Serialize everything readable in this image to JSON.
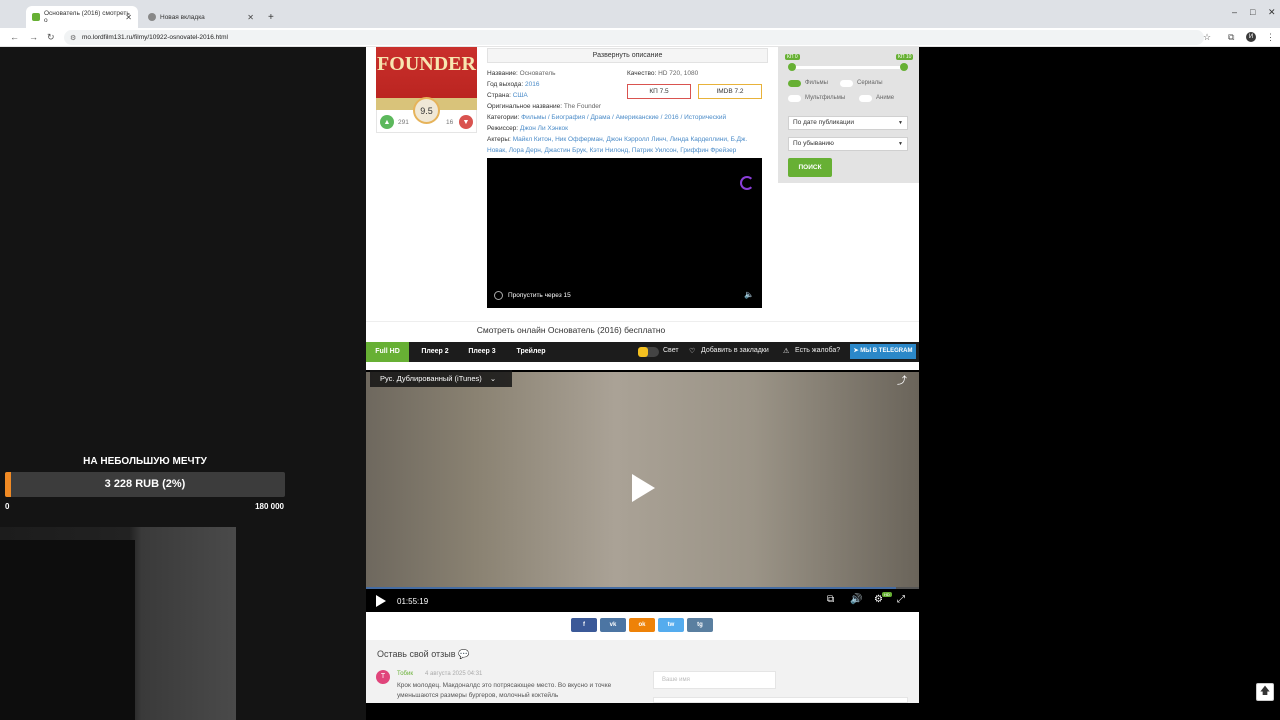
{
  "browser": {
    "tabs": [
      {
        "title": "Основатель (2016) смотреть о",
        "active": true
      },
      {
        "title": "Новая вкладка",
        "active": false
      }
    ],
    "new_tab": "+",
    "url": "mo.lordfilm131.ru/filmy/10922-osnovatel-2016.html",
    "win_controls": [
      "–",
      "□",
      "✕"
    ]
  },
  "donation": {
    "title": "НА НЕБОЛЬШУЮ МЕЧТУ",
    "amount": "3 228 RUB (2%)",
    "min": "0",
    "max": "180 000",
    "progress_fraction": 0.018
  },
  "movie": {
    "poster_title": "FOUNDER",
    "rating": "9.5",
    "likes": "291",
    "dislikes": "16",
    "expand_description": "Развернуть описание",
    "fields": {
      "name_label": "Название:",
      "name": "Основатель",
      "year_label": "Год выхода:",
      "year": "2016",
      "country_label": "Страна:",
      "country": "США",
      "orig_label": "Оригинальное название:",
      "orig": "The Founder",
      "cat_label": "Категории:",
      "categories": "Фильмы / Биография / Драма / Американские / 2016 / Исторический",
      "director_label": "Режиссер:",
      "director": "Джон Ли Хэнкок",
      "actors_label": "Актеры:",
      "actors_line1": "Майкл Китон, Ник Офферман, Джон Кэрролл Линч, Линда Карделлини, Б.Дж.",
      "actors_line2": "Новак, Лора Дерн, Джастин Брук, Кэти Нилонд, Патрик Уилсон, Гриффин Фрейзер",
      "quality_label": "Качество:",
      "quality": "HD 720, 1080"
    },
    "kp": "КП 7.5",
    "imdb": "IMDB 7.2",
    "ad_skip": "Пропустить через 15",
    "watch_title": "Смотреть онлайн Основатель (2016) бесплатно"
  },
  "player_tabs": [
    "Full HD",
    "Плеер 2",
    "Плеер 3",
    "Трейлер"
  ],
  "player_tools": {
    "light": "Свет",
    "bookmark": "Добавить в закладки",
    "complaint": "Есть жалоба?",
    "telegram": "МЫ В TELEGRAM"
  },
  "player": {
    "audio_track": "Рус. Дублированный (iTunes)",
    "time": "01:55:19",
    "hd_badge": "HD"
  },
  "share": [
    {
      "label": "f",
      "color": "#3b5998"
    },
    {
      "label": "vk",
      "color": "#4c75a3"
    },
    {
      "label": "ok",
      "color": "#ee8208"
    },
    {
      "label": "tw",
      "color": "#55acee"
    },
    {
      "label": "tg",
      "color": "#5a7fa0"
    }
  ],
  "comments": {
    "title": "Оставь свой отзыв",
    "avatar_letter": "Т",
    "author": "Тобик",
    "date": "4 августа 2025 04:31",
    "text": "Крок молодец. Макдоналдс это потрясающее место. Во вкусно и точке уменьшаются размеры бургеров, молочный коктейль",
    "name_placeholder": "Ваше имя"
  },
  "filter": {
    "kp_from": "КП 0",
    "kp_to": "КП 10",
    "toggles": [
      {
        "label": "Фильмы",
        "on": true
      },
      {
        "label": "Сериалы",
        "on": false
      },
      {
        "label": "Мультфильмы",
        "on": false
      },
      {
        "label": "Аниме",
        "on": false
      }
    ],
    "sort_by": "По дате публикации",
    "order": "По убыванию",
    "search": "ПОИСК"
  }
}
